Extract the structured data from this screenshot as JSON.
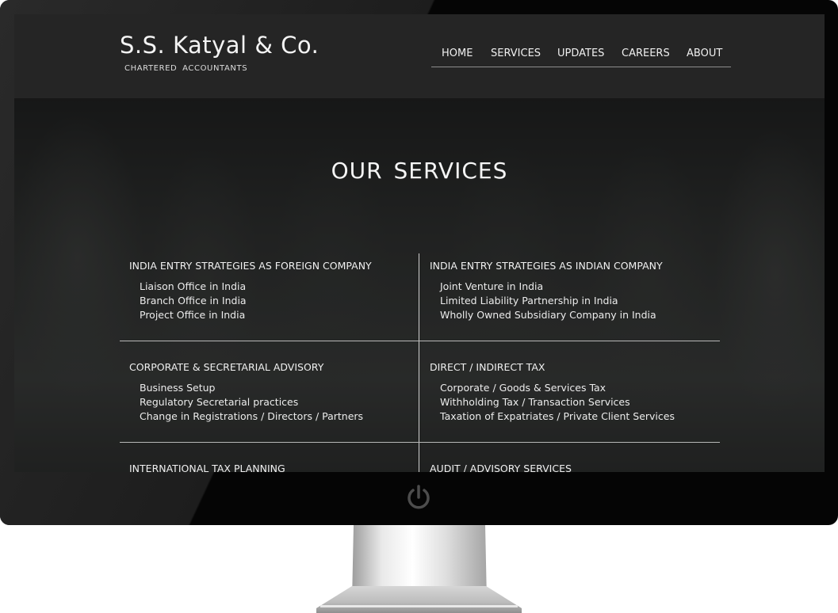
{
  "brand": {
    "title": "S.S. Katyal & Co.",
    "subtitle": "CHARTERED ACCOUNTANTS"
  },
  "nav": {
    "items": [
      {
        "label": "HOME"
      },
      {
        "label": "SERVICES"
      },
      {
        "label": "UPDATES"
      },
      {
        "label": "CAREERS"
      },
      {
        "label": "ABOUT"
      }
    ]
  },
  "main": {
    "title": "OUR SERVICES",
    "services": [
      {
        "title": "INDIA ENTRY STRATEGIES AS FOREIGN COMPANY",
        "items": [
          "Liaison Office in India",
          "Branch Office in India",
          "Project Office in India"
        ]
      },
      {
        "title": "INDIA ENTRY STRATEGIES AS INDIAN COMPANY",
        "items": [
          "Joint Venture in India",
          "Limited Liability Partnership in India",
          "Wholly Owned Subsidiary Company in India"
        ]
      },
      {
        "title": "CORPORATE & SECRETARIAL ADVISORY",
        "items": [
          "Business Setup",
          "Regulatory Secretarial practices",
          "Change in Registrations / Directors / Partners"
        ]
      },
      {
        "title": "DIRECT / INDIRECT TAX",
        "items": [
          "Corporate / Goods & Services Tax",
          "Withholding Tax / Transaction Services",
          "Taxation of Expatriates / Private Client Services"
        ]
      },
      {
        "title": "INTERNATIONAL TAX PLANNING",
        "items": []
      },
      {
        "title": "AUDIT / ADVISORY SERVICES",
        "items": []
      }
    ]
  },
  "device": {
    "power_icon": "power-icon"
  }
}
